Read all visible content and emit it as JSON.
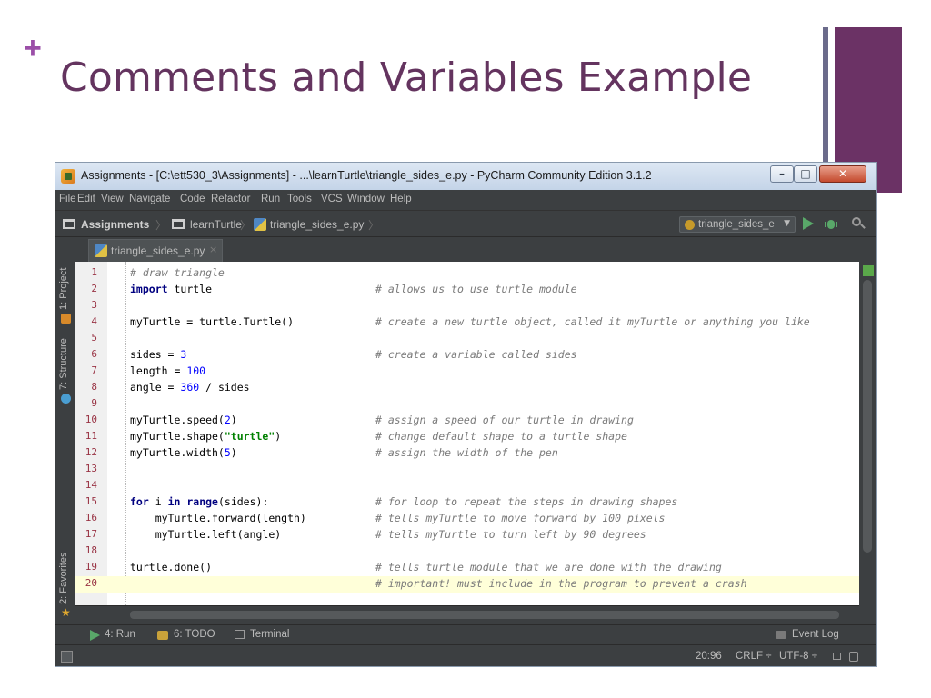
{
  "slide": {
    "plus": "+",
    "title": "Comments and Variables Example"
  },
  "window": {
    "title": "Assignments - [C:\\ett530_3\\Assignments] - ...\\learnTurtle\\triangle_sides_e.py - PyCharm Community Edition 3.1.2",
    "minimize": "–",
    "maximize": "□",
    "close": "✕"
  },
  "menu": [
    "File",
    "Edit",
    "View",
    "Navigate",
    "Code",
    "Refactor",
    "Run",
    "Tools",
    "VCS",
    "Window",
    "Help"
  ],
  "nav": {
    "project": "Assignments",
    "folder": "learnTurtle",
    "file": "triangle_sides_e.py",
    "sep": "〉",
    "run_config": "triangle_sides_e",
    "run_config_arrow": "▼"
  },
  "left_tabs": {
    "project": "1: Project",
    "structure": "7: Structure",
    "favorites": "2: Favorites"
  },
  "tab": {
    "label": "triangle_sides_e.py",
    "close": "×"
  },
  "code_lines": [
    {
      "n": "1",
      "code": "",
      "comment": "# draw triangle",
      "comment_inline": true
    },
    {
      "n": "2",
      "code": "import turtle",
      "comment": "# allows us to use turtle module"
    },
    {
      "n": "3",
      "code": "",
      "comment": ""
    },
    {
      "n": "4",
      "code": "myTurtle = turtle.Turtle()",
      "comment": "# create a new turtle object, called it myTurtle or anything you like"
    },
    {
      "n": "5",
      "code": "",
      "comment": ""
    },
    {
      "n": "6",
      "code": "sides = 3",
      "comment": "# create a variable called sides"
    },
    {
      "n": "7",
      "code": "length = 100",
      "comment": ""
    },
    {
      "n": "8",
      "code": "angle = 360 / sides",
      "comment": ""
    },
    {
      "n": "9",
      "code": "",
      "comment": ""
    },
    {
      "n": "10",
      "code": "myTurtle.speed(2)",
      "comment": "# assign a speed of our turtle in drawing"
    },
    {
      "n": "11",
      "code": "myTurtle.shape(\"turtle\")",
      "comment": "# change default shape to a turtle shape"
    },
    {
      "n": "12",
      "code": "myTurtle.width(5)",
      "comment": "# assign the width of the pen"
    },
    {
      "n": "13",
      "code": "",
      "comment": ""
    },
    {
      "n": "14",
      "code": "",
      "comment": ""
    },
    {
      "n": "15",
      "code": "for i in range(sides):",
      "comment": "# for loop to repeat the steps in drawing shapes"
    },
    {
      "n": "16",
      "code": "    myTurtle.forward(length)",
      "comment": "# tells myTurtle to move forward by 100 pixels"
    },
    {
      "n": "17",
      "code": "    myTurtle.left(angle)",
      "comment": "# tells myTurtle to turn left by 90 degrees"
    },
    {
      "n": "18",
      "code": "",
      "comment": ""
    },
    {
      "n": "19",
      "code": "turtle.done()",
      "comment": "# tells turtle module that we are done with the drawing"
    },
    {
      "n": "20",
      "code": "",
      "comment": "# important! must include in the program to prevent a crash",
      "current": true
    }
  ],
  "bottom": {
    "run": "4: Run",
    "todo": "6: TODO",
    "terminal": "Terminal",
    "event_log": "Event Log"
  },
  "status": {
    "position": "20:96",
    "line_sep": "CRLF ÷",
    "encoding": "UTF-8 ÷"
  },
  "colors": {
    "slide_title": "#64345f",
    "slide_accent": "#9b4fa8",
    "deco_bar": "#6b3265",
    "ide_bg": "#3c3f41",
    "editor_bg": "#ffffff",
    "current_line": "#ffffd9",
    "run_green": "#59a869"
  }
}
